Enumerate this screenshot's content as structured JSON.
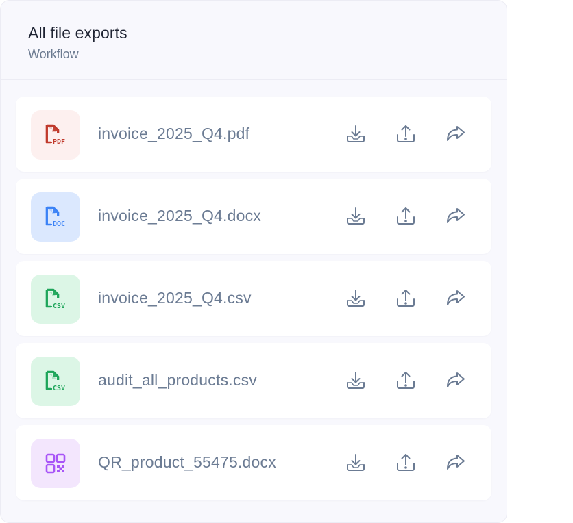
{
  "header": {
    "title": "All file exports",
    "subtitle": "Workflow"
  },
  "colors": {
    "pdf_red": "#c0392b",
    "pdf_bg": "#fdf0ef",
    "doc_blue": "#3b82f6",
    "doc_bg": "#dbe8fe",
    "csv_green": "#1ea55a",
    "csv_bg": "#dcf6e6",
    "qr_purple": "#a855f7",
    "qr_bg": "#f3e6fd",
    "action_icon": "#6b7b93"
  },
  "files": [
    {
      "name": "invoice_2025_Q4.pdf",
      "type": "pdf",
      "badge_text": "PDF",
      "icon": "pdf-file-icon"
    },
    {
      "name": "invoice_2025_Q4.docx",
      "type": "doc",
      "badge_text": "DOC",
      "icon": "doc-file-icon"
    },
    {
      "name": "invoice_2025_Q4.csv",
      "type": "csv",
      "badge_text": "CSV",
      "icon": "csv-file-icon"
    },
    {
      "name": "audit_all_products.csv",
      "type": "csv",
      "badge_text": "CSV",
      "icon": "csv-file-icon"
    },
    {
      "name": "QR_product_55475.docx",
      "type": "qr",
      "badge_text": "",
      "icon": "qr-code-icon"
    }
  ],
  "actions": [
    {
      "name": "download",
      "icon": "download-icon"
    },
    {
      "name": "upload",
      "icon": "upload-icon"
    },
    {
      "name": "share",
      "icon": "share-forward-icon"
    }
  ]
}
